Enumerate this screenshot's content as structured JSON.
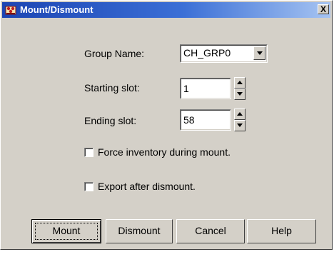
{
  "window": {
    "title": "Mount/Dismount",
    "close_glyph": "X",
    "icon": "app-icon"
  },
  "form": {
    "group_name": {
      "label": "Group Name:",
      "value": "CH_GRP0"
    },
    "starting_slot": {
      "label": "Starting slot:",
      "value": "1"
    },
    "ending_slot": {
      "label": "Ending slot:",
      "value": "58"
    },
    "force_inventory": {
      "label": "Force inventory during mount.",
      "checked": false
    },
    "export_after": {
      "label": "Export after dismount.",
      "checked": false
    }
  },
  "buttons": {
    "mount": "Mount",
    "dismount": "Dismount",
    "cancel": "Cancel",
    "help": "Help"
  },
  "colors": {
    "face": "#d4d0c8",
    "title_start": "#1c45b3",
    "title_end": "#a6c4f2"
  }
}
